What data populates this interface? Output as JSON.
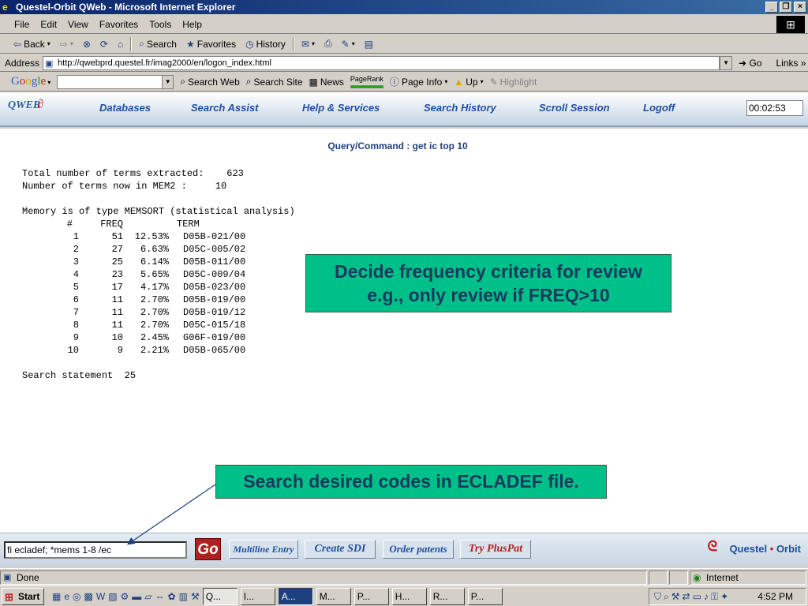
{
  "window": {
    "title": "Questel-Orbit QWeb - Microsoft Internet Explorer",
    "ie_icon": "ie-icon"
  },
  "menu": [
    "File",
    "Edit",
    "View",
    "Favorites",
    "Tools",
    "Help"
  ],
  "toolbar": {
    "back": "Back",
    "forward": "",
    "search": "Search",
    "favorites": "Favorites",
    "history": "History"
  },
  "address": {
    "label": "Address",
    "url": "http://qwebprd.questel.fr/imag2000/en/logon_index.html",
    "go": "Go",
    "links": "Links"
  },
  "google": {
    "logo": "Google",
    "search_web": "Search Web",
    "search_site": "Search Site",
    "news": "News",
    "pagerank": "PageRank",
    "page_info": "Page Info",
    "up": "Up",
    "highlight": "Highlight"
  },
  "qweb": {
    "logo": "QWEB",
    "nav": [
      "Databases",
      "Search Assist",
      "Help & Services",
      "Search History",
      "Scroll Session",
      "Logoff"
    ],
    "timer": "00:02:53"
  },
  "content": {
    "query_title": "Query/Command : get ic top 10",
    "summary_line1": "Total number of terms extracted:    623",
    "summary_line2": "Number of terms now in MEM2 :     10",
    "memory_line": "Memory is of type MEMSORT (statistical analysis)",
    "table_header": {
      "num": "#",
      "freq": "FREQ",
      "pct": "",
      "term": "TERM"
    },
    "rows": [
      {
        "num": "1",
        "freq": "51",
        "pct": "12.53%",
        "term": "D05B-021/00"
      },
      {
        "num": "2",
        "freq": "27",
        "pct": "6.63%",
        "term": "D05C-005/02"
      },
      {
        "num": "3",
        "freq": "25",
        "pct": "6.14%",
        "term": "D05B-011/00"
      },
      {
        "num": "4",
        "freq": "23",
        "pct": "5.65%",
        "term": "D05C-009/04"
      },
      {
        "num": "5",
        "freq": "17",
        "pct": "4.17%",
        "term": "D05B-023/00"
      },
      {
        "num": "6",
        "freq": "11",
        "pct": "2.70%",
        "term": "D05B-019/00"
      },
      {
        "num": "7",
        "freq": "11",
        "pct": "2.70%",
        "term": "D05B-019/12"
      },
      {
        "num": "8",
        "freq": "11",
        "pct": "2.70%",
        "term": "D05C-015/18"
      },
      {
        "num": "9",
        "freq": "10",
        "pct": "2.45%",
        "term": "G06F-019/00"
      },
      {
        "num": "10",
        "freq": "9",
        "pct": "2.21%",
        "term": "D05B-065/00"
      }
    ],
    "search_statement": "Search statement  25",
    "callout1_line1": "Decide frequency criteria for review",
    "callout1_line2": "e.g., only review if FREQ>10",
    "callout2": "Search desired codes in ECLADEF file."
  },
  "command": {
    "input_value": "fi ecladef; *mems 1-8 /ec",
    "go": "Go",
    "multiline": "Multiline Entry",
    "create_sdi": "Create SDI",
    "order_patents": "Order patents",
    "try_pluspat": "Try PlusPat",
    "brand_left": "Questel",
    "brand_dot": "•",
    "brand_right": "Orbit"
  },
  "status": {
    "text": "Done",
    "zone": "Internet"
  },
  "taskbar": {
    "start": "Start",
    "tasks": [
      "Q...",
      "I...",
      "A...",
      "M...",
      "P...",
      "H...",
      "R...",
      "P..."
    ],
    "clock": "4:52 PM"
  },
  "colors": {
    "callout": "#00c08a",
    "nav_text": "#1e4fa0",
    "go_red": "#b02020"
  }
}
